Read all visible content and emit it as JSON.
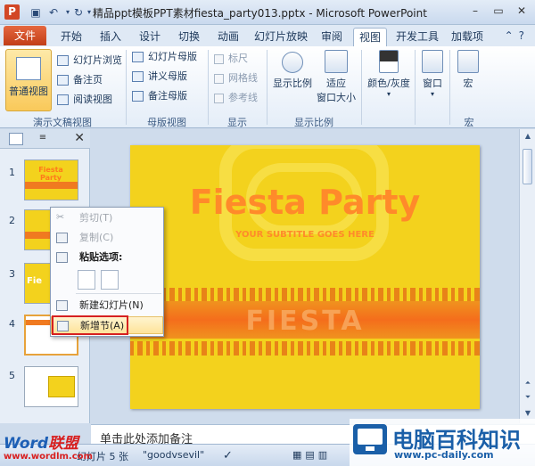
{
  "window": {
    "title": "精品ppt模板PPT素材fiesta_party013.pptx - Microsoft PowerPoint",
    "app_icon": "P"
  },
  "tabs": {
    "file": "文件",
    "items": [
      "开始",
      "插入",
      "设计",
      "切换",
      "动画",
      "幻灯片放映",
      "审阅",
      "视图",
      "开发工具",
      "加载项"
    ],
    "active": "视图"
  },
  "ribbon": {
    "normal_view": "普通视图",
    "slide_sorter": "幻灯片浏览",
    "notes_page": "备注页",
    "reading_view": "阅读视图",
    "slide_master": "幻灯片母版",
    "handout_master": "讲义母版",
    "notes_master": "备注母版",
    "ruler": "标尺",
    "gridlines": "网格线",
    "guides": "参考线",
    "zoom": "显示比例",
    "fit_window_1": "适应",
    "fit_window_2": "窗口大小",
    "color_gray": "颜色/灰度",
    "window": "窗口",
    "macros": "宏",
    "groups": {
      "presentation_views": "演示文稿视图",
      "master_views": "母版视图",
      "show": "显示",
      "zoom": "显示比例",
      "macros": "宏"
    }
  },
  "slides": [
    {
      "num": "1"
    },
    {
      "num": "2"
    },
    {
      "num": "3"
    },
    {
      "num": "4"
    },
    {
      "num": "5"
    }
  ],
  "thumb_text": {
    "t1": "Fiesta Party",
    "t3": "Fie"
  },
  "slide": {
    "title": "Fiesta Party",
    "subtitle": "YOUR SUBTITLE GOES HERE",
    "banner": "FIESTA"
  },
  "context_menu": {
    "cut": "剪切(T)",
    "copy": "复制(C)",
    "paste_options": "粘贴选项:",
    "new_slide": "新建幻灯片(N)",
    "new_section": "新增节(A)"
  },
  "notes": {
    "placeholder": "单击此处添加备注"
  },
  "status": {
    "slide_info": "幻灯片 5 张",
    "theme": "\"goodvsevil\""
  },
  "watermarks": {
    "left_word_1": "Word",
    "left_word_2": "联盟",
    "left_url": "www.wordlm.com",
    "right_title": "电脑百科知识",
    "right_url": "www.pc-daily.com"
  },
  "colors": {
    "file_tab": "#c23e17",
    "slide_bg": "#f3d21d",
    "slide_title": "#ff8a2a",
    "highlight_border": "#d62020"
  }
}
